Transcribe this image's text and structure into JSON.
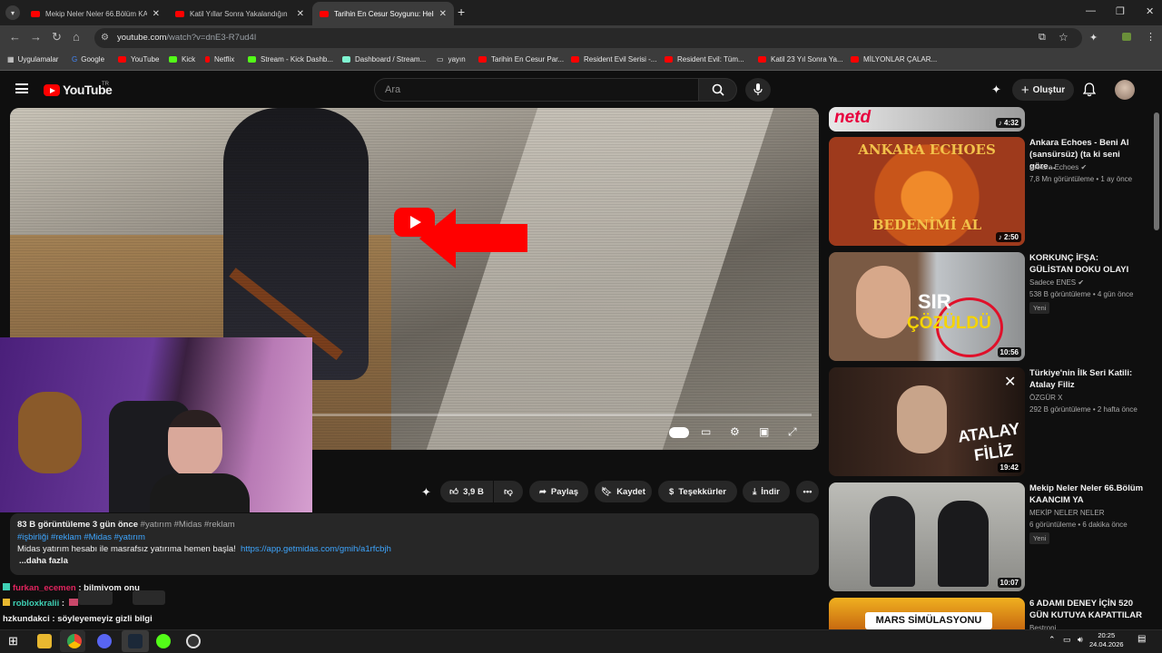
{
  "browser": {
    "tabs": [
      {
        "label": "Mekip Neler Neler 66.Bölüm KA",
        "active": false
      },
      {
        "label": "Katil Yıllar Sonra Yakalandığın",
        "active": false
      },
      {
        "label": "Tarihin En Cesur Soygunu: Heli",
        "active": true
      }
    ],
    "new_tab": "+",
    "url_host": "youtube.com",
    "url_path": "/watch?v=dnE3-R7ud4I",
    "bookmarks": [
      "Uygulamalar",
      "Google",
      "YouTube",
      "Kick",
      "Netflix",
      "Stream - Kick Dashb...",
      "Dashboard / Stream...",
      "yayın",
      "Tarihin En Cesur Par...",
      "Resident Evil Serisi -...",
      "Resident Evil: Tüm...",
      "Katil 23 Yıl Sonra Ya...",
      "MİLYONLAR ÇALAR..."
    ]
  },
  "header": {
    "logo": "YouTube",
    "logo_sup": "TR",
    "search_placeholder": "Ara",
    "create_label": "Oluştur"
  },
  "actions": {
    "likes": "3,9 B",
    "share": "Paylaş",
    "save": "Kaydet",
    "thanks": "Teşekkürler",
    "download": "İndir"
  },
  "description": {
    "stats": "83 B görüntüleme  3 gün önce",
    "stats_tags": "#yatırım #Midas #reklam",
    "tags": "#işbirliği #reklam #Midas #yatırım",
    "text": "Midas yatırım hesabı ile masrafsız yatırıma hemen başla!",
    "link": "https://app.getmidas.com/gmih/a1rfcbjh",
    "more": "...daha fazla"
  },
  "chat": [
    {
      "user": "furkan_ecemen",
      "sep": " : ",
      "msg": "bilmiyom onu",
      "color": "#e0245e"
    },
    {
      "user": "robloxkralii",
      "sep": " : ",
      "msg": "",
      "color": "#3fd0b5"
    },
    {
      "user": "hzkundakci",
      "sep": " : ",
      "msg": "söyleyemeyiz gizli bilgi",
      "color": "#f1f1f1"
    }
  ],
  "sidebar": [
    {
      "title": "",
      "channel": "",
      "meta": "",
      "duration": "4:32",
      "thumb_text": "netd",
      "badge": ""
    },
    {
      "title": "Ankara Echoes - Beni Al (sansürsüz) (ta ki seni göre...",
      "channel": "Ankara Echoes",
      "meta": "7,8 Mn görüntüleme • 1 ay önce",
      "duration": "2:50",
      "thumb_text": "ANKARA ECHOES",
      "thumb_text2": "BEDENİMİ AL",
      "badge": ""
    },
    {
      "title": "KORKUNÇ İFŞA: GÜLİSTAN DOKU OLAYI",
      "channel": "Sadece ENES",
      "meta": "538 B görüntüleme • 4 gün önce",
      "duration": "10:56",
      "thumb_text": "SIR",
      "thumb_text2": "ÇÖZÜLDÜ",
      "badge": "Yeni"
    },
    {
      "title": "Türkiye'nin İlk Seri Katili: Atalay Filiz",
      "channel": "ÖZGÜR X",
      "meta": "292 B görüntüleme • 2 hafta önce",
      "duration": "19:42",
      "thumb_text": "ATALAY",
      "thumb_text2": "FİLİZ",
      "badge": ""
    },
    {
      "title": "Mekip Neler Neler 66.Bölüm KAANCIM YA",
      "channel": "MEKİP NELER NELER",
      "meta": "6 görüntüleme • 6 dakika önce",
      "duration": "10:07",
      "badge": "Yeni"
    },
    {
      "title": "6 ADAMI DENEY İÇİN 520 GÜN KUTUYA KAPATTILAR",
      "channel": "Bestroni",
      "meta": "",
      "duration": "",
      "thumb_text": "MARS SİMÜLASYONU",
      "badge": ""
    }
  ],
  "taskbar": {
    "time": "20:25",
    "date": "24.04.2026"
  }
}
